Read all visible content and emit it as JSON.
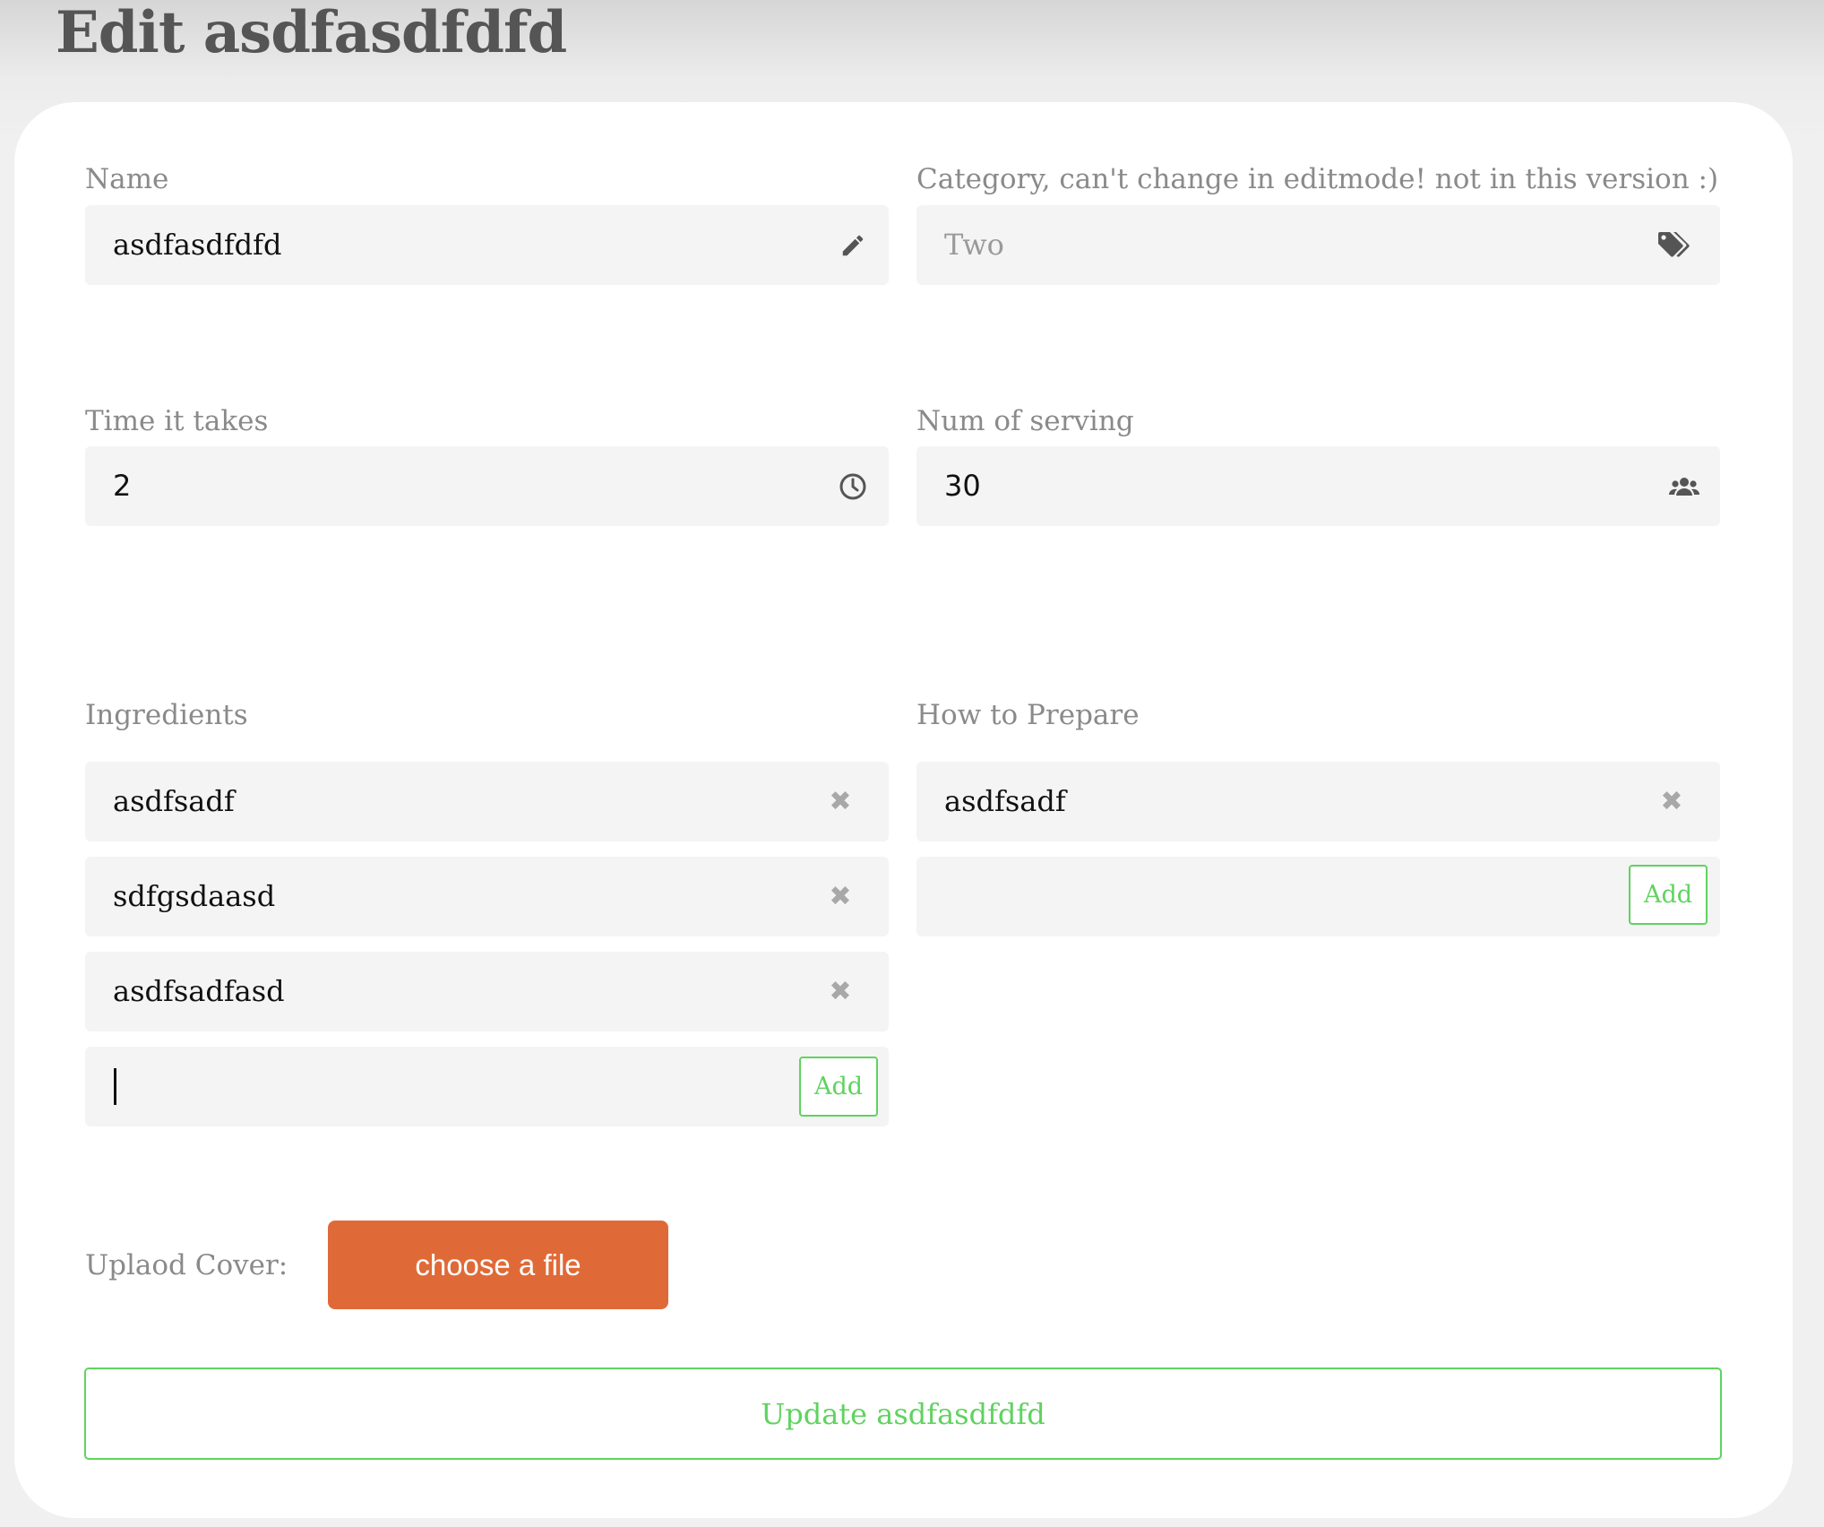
{
  "page": {
    "title": "Edit asdfasdfdfd"
  },
  "name": {
    "label": "Name",
    "value": "asdfasdfdfd"
  },
  "category": {
    "label": "Category, can't change in editmode! not in this version :)",
    "value": "Two"
  },
  "time": {
    "label": "Time it takes",
    "value": "2"
  },
  "servings": {
    "label": "Num of serving",
    "value": "30"
  },
  "ingredients": {
    "label": "Ingredients",
    "items": [
      {
        "text": "asdfsadf"
      },
      {
        "text": "sdfgsdaasd"
      },
      {
        "text": "asdfsadfasd"
      }
    ],
    "new_value": "",
    "add_label": "Add"
  },
  "prepare": {
    "label": "How to Prepare",
    "items": [
      {
        "text": "asdfsadf"
      }
    ],
    "new_value": "",
    "add_label": "Add"
  },
  "upload": {
    "label": "Uplaod Cover:",
    "button_label": "choose a file"
  },
  "submit": {
    "label": "Update asdfasdfdfd"
  },
  "icons": {
    "name": "pencil-icon",
    "category": "tags-icon",
    "time": "clock-icon",
    "servings": "users-icon",
    "remove": "times-icon"
  },
  "colors": {
    "accent_green": "#5fd35f",
    "upload_orange": "#e06a37",
    "field_bg": "#f4f4f4",
    "label_gray": "#8a8a8a"
  }
}
